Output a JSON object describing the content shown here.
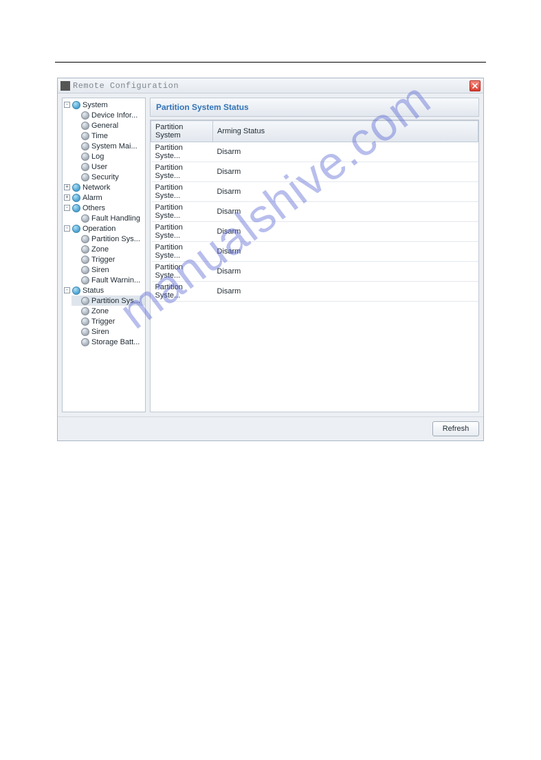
{
  "watermark": "manualshive.com",
  "window_title": "Remote Configuration",
  "close_tooltip": "Close",
  "tree": {
    "system": {
      "label": "System",
      "items": [
        {
          "label": "Device Infor..."
        },
        {
          "label": "General"
        },
        {
          "label": "Time"
        },
        {
          "label": "System Mai..."
        },
        {
          "label": "Log"
        },
        {
          "label": "User"
        },
        {
          "label": "Security"
        }
      ]
    },
    "network": {
      "label": "Network"
    },
    "alarm": {
      "label": "Alarm"
    },
    "others": {
      "label": "Others",
      "items": [
        {
          "label": "Fault Handling"
        }
      ]
    },
    "operation": {
      "label": "Operation",
      "items": [
        {
          "label": "Partition Sys..."
        },
        {
          "label": "Zone"
        },
        {
          "label": "Trigger"
        },
        {
          "label": "Siren"
        },
        {
          "label": "Fault Warnin..."
        }
      ]
    },
    "status": {
      "label": "Status",
      "items": [
        {
          "label": "Partition Sys...",
          "selected": true
        },
        {
          "label": "Zone"
        },
        {
          "label": "Trigger"
        },
        {
          "label": "Siren"
        },
        {
          "label": "Storage Batt..."
        }
      ]
    }
  },
  "section_title": "Partition System Status",
  "table": {
    "columns": [
      "Partition System",
      "Arming Status"
    ],
    "rows": [
      {
        "partition": "Partition Syste...",
        "status": "Disarm"
      },
      {
        "partition": "Partition Syste...",
        "status": "Disarm"
      },
      {
        "partition": "Partition Syste...",
        "status": "Disarm"
      },
      {
        "partition": "Partition Syste...",
        "status": "Disarm"
      },
      {
        "partition": "Partition Syste...",
        "status": "Disarm"
      },
      {
        "partition": "Partition Syste...",
        "status": "Disarm"
      },
      {
        "partition": "Partition Syste...",
        "status": "Disarm"
      },
      {
        "partition": "Partition Syste...",
        "status": "Disarm"
      }
    ]
  },
  "buttons": {
    "refresh": "Refresh"
  }
}
